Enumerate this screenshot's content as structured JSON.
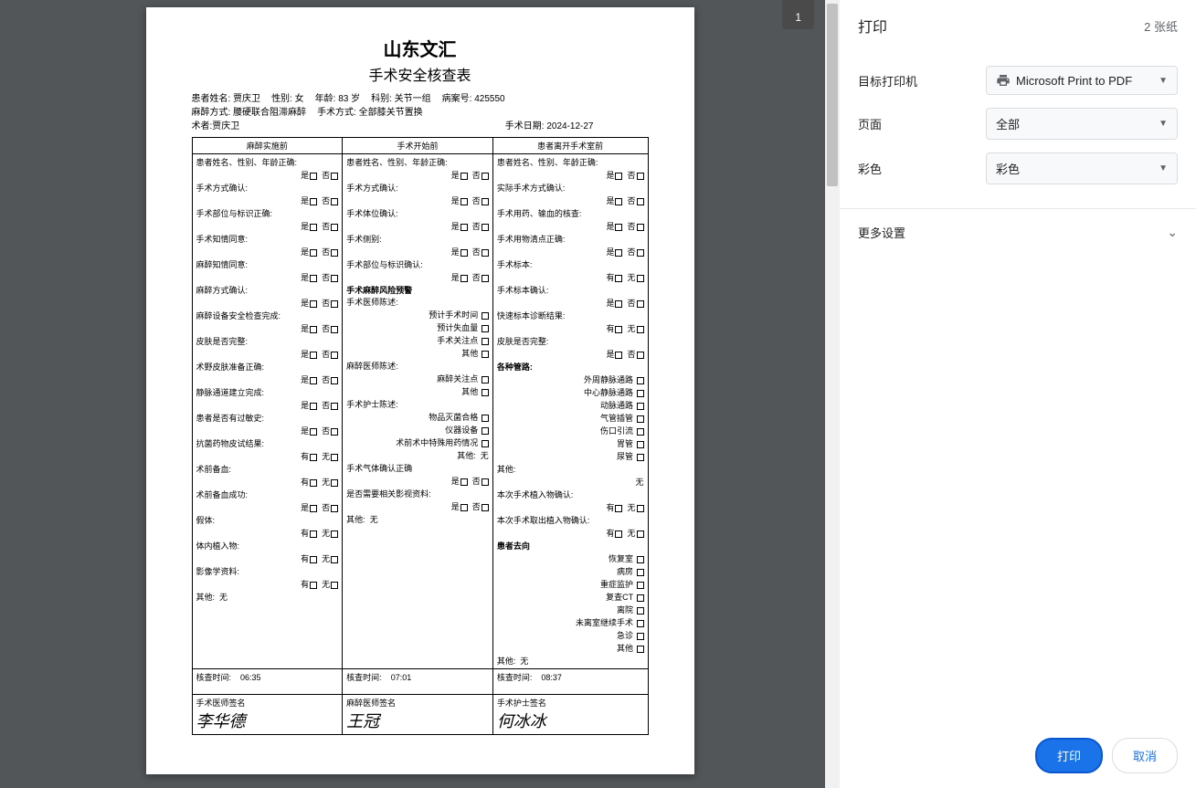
{
  "preview": {
    "page_badge": "1",
    "doc": {
      "title": "山东文汇",
      "subtitle": "手术安全核查表",
      "patient": {
        "name_lbl": "患者姓名:",
        "name": "贾庆卫",
        "sex_lbl": "性别:",
        "sex": "女",
        "age_lbl": "年龄:",
        "age": "83 岁",
        "dept_lbl": "科别:",
        "dept": "关节一组",
        "case_lbl": "病案号:",
        "case": "425550",
        "anes_lbl": "麻醉方式:",
        "anes": "腰硬联合阻滞麻醉",
        "surg_lbl": "手术方式:",
        "surg": "全部膝关节置换",
        "surgeon_lbl": "术者:",
        "surgeon": "贾庆卫",
        "date_lbl": "手术日期:",
        "date": "2024-12-27"
      },
      "cols": {
        "col1_header": "麻醉实施前",
        "col2_header": "手术开始前",
        "col3_header": "患者离开手术室前"
      },
      "yn": {
        "yes": "是",
        "no": "否",
        "have": "有",
        "none": "无"
      },
      "col1": {
        "r1": "患者姓名、性别、年龄正确:",
        "r2": "手术方式确认:",
        "r3": "手术部位与标识正确:",
        "r4": "手术知情同意:",
        "r5": "麻醉知情同意:",
        "r6": "麻醉方式确认:",
        "r7": "麻醉设备安全检查完成:",
        "r8": "皮肤是否完整:",
        "r9": "术野皮肤准备正确:",
        "r10": "静脉通道建立完成:",
        "r11": "患者是否有过敏史:",
        "r12": "抗菌药物皮试结果:",
        "r13": "术前备血:",
        "r14": "术前备血成功:",
        "r15": "假体:",
        "r16": "体内植入物:",
        "r17": "影像学资料:",
        "other_lbl": "其他:",
        "other_val": "无"
      },
      "col2": {
        "r1": "患者姓名、性别、年龄正确:",
        "r2": "手术方式确认:",
        "r3": "手术体位确认:",
        "r4": "手术侧别:",
        "r5": "手术部位与标识确认:",
        "warn_hdr": "手术麻醉风险预警",
        "surg_dr": "手术医师陈述:",
        "w1": "预计手术时间",
        "w2": "预计失血量",
        "w3": "手术关注点",
        "w4": "其他",
        "anes_dr": "麻醉医师陈述:",
        "a1": "麻醉关注点",
        "a2": "其他",
        "nurse": "手术护士陈述:",
        "n1": "物品灭菌合格",
        "n2": "仪器设备",
        "n3": "术前术中特殊用药情况",
        "n4_lbl": "其他:",
        "n4_val": "无",
        "gas": "手术气体确认正确",
        "img": "是否需要相关影视资料:",
        "other_lbl": "其他:",
        "other_val": "无"
      },
      "col3": {
        "r1": "患者姓名、性别、年龄正确:",
        "r2": "实际手术方式确认:",
        "r3": "手术用药、输血的核查:",
        "r4": "手术用物清点正确:",
        "r5": "手术标本:",
        "r6": "手术标本确认:",
        "r7": "快速标本诊断结果:",
        "r8": "皮肤是否完整:",
        "tubes_hdr": "各种管路:",
        "t1": "外周静脉通路",
        "t2": "中心静脉通路",
        "t3": "动脉通路",
        "t4": "气管插管",
        "t5": "伤口引流",
        "t6": "胃管",
        "t7": "尿管",
        "other1_lbl": "其他:",
        "other1_val": "无",
        "implant": "本次手术植入物确认:",
        "explant": "本次手术取出植入物确认:",
        "dest_hdr": "患者去向",
        "d1": "恢复室",
        "d2": "病房",
        "d3": "重症监护",
        "d4": "复查CT",
        "d5": "离院",
        "d6": "未离室继续手术",
        "d7": "急诊",
        "d8": "其他",
        "other2_lbl": "其他:",
        "other2_val": "无"
      },
      "sigs": {
        "time_lbl": "核查时间:",
        "t1": "06:35",
        "t2": "07:01",
        "t3": "08:37",
        "s1_lbl": "手术医师签名",
        "s2_lbl": "麻醉医师签名",
        "s3_lbl": "手术护士签名",
        "s1": "李华德",
        "s2": "王冠",
        "s3": "何冰冰"
      }
    }
  },
  "sidebar": {
    "title": "打印",
    "pages_info": "2 张纸",
    "dest_lbl": "目标打印机",
    "dest_val": "Microsoft Print to PDF",
    "pages_lbl": "页面",
    "pages_val": "全部",
    "color_lbl": "彩色",
    "color_val": "彩色",
    "more_lbl": "更多设置",
    "print_btn": "打印",
    "cancel_btn": "取消"
  }
}
